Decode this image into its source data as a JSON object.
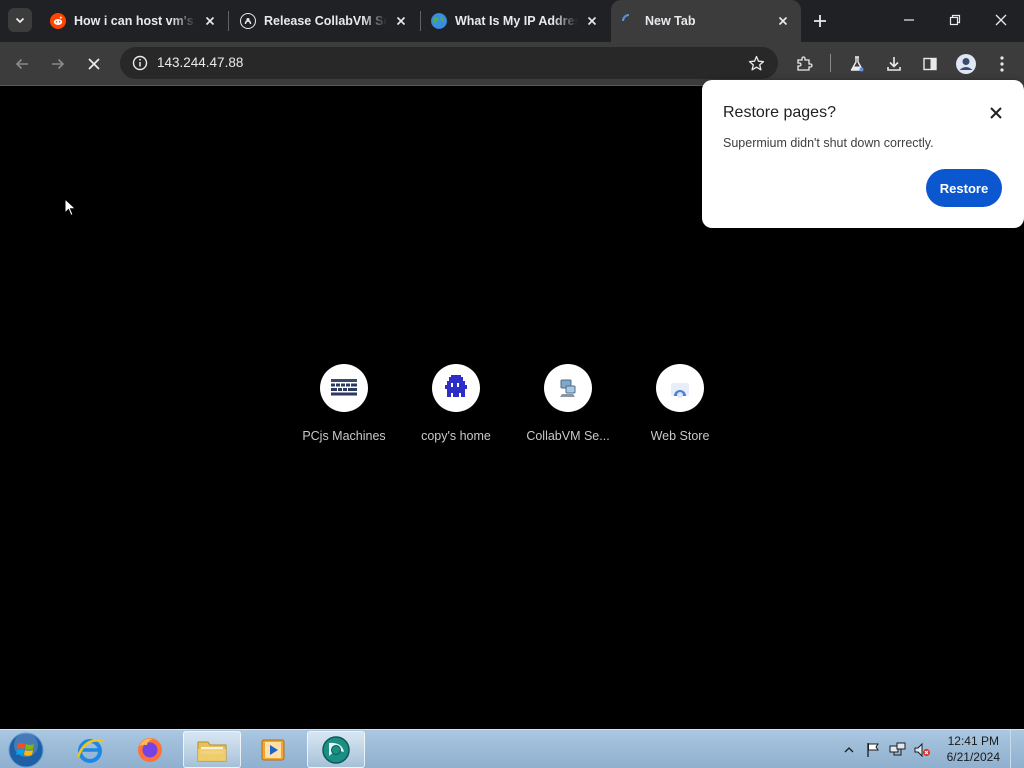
{
  "tabs": [
    {
      "title": "How i can host vm's on",
      "favicon": "reddit-icon",
      "color": "#ff4500"
    },
    {
      "title": "Release CollabVM Server",
      "favicon": "github-icon",
      "color": "#24292f"
    },
    {
      "title": "What Is My IP Address",
      "favicon": "globe-icon",
      "color": "#2e7dd1"
    },
    {
      "title": "New Tab",
      "favicon": "loading-icon",
      "color": "#3c3c3c"
    }
  ],
  "toolbar": {
    "url": "143.244.47.88"
  },
  "shortcuts": [
    {
      "label": "PCjs Machines",
      "icon": "pcjs-icon"
    },
    {
      "label": "copy's home",
      "icon": "pixel-creature-icon"
    },
    {
      "label": "CollabVM Se...",
      "icon": "collabvm-icon"
    },
    {
      "label": "Web Store",
      "icon": "webstore-icon"
    }
  ],
  "popup": {
    "title": "Restore pages?",
    "message": "Supermium didn't shut down correctly.",
    "button": "Restore"
  },
  "taskbar": {
    "time": "12:41 PM",
    "date": "6/21/2024"
  },
  "colors": {
    "tabstrip": "#202124",
    "toolbar": "#3c3c3c",
    "accent": "#0b57d0"
  }
}
